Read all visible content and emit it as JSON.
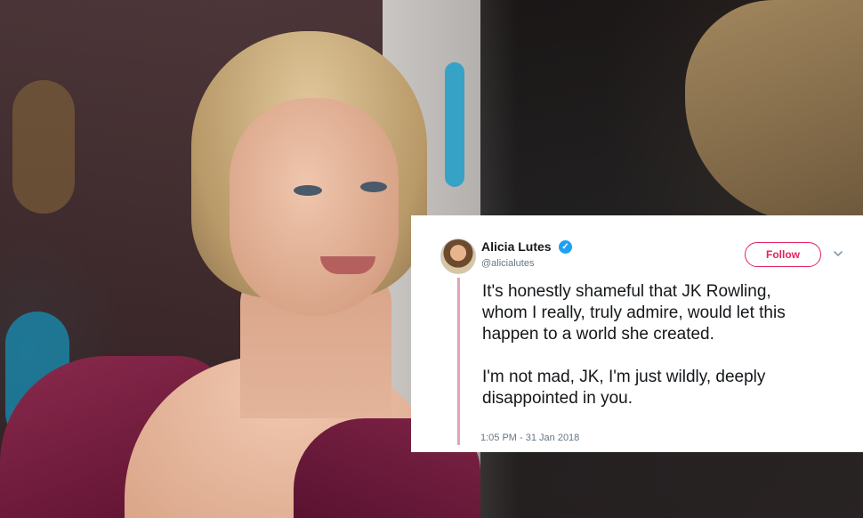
{
  "tweet": {
    "name": "Alicia Lutes",
    "handle": "@alicialutes",
    "follow_label": "Follow",
    "text": "It's honestly shameful that JK Rowling,\nwhom I really, truly admire, would let this\nhappen to a world she created.\n\nI'm not mad, JK, I'm just wildly, deeply\ndisappointed in you.",
    "timestamp": "1:05 PM - 31 Jan 2018",
    "colors": {
      "follow": "#e0245e",
      "verified": "#1da1f2",
      "thread_line": "#e3a3b8"
    },
    "icons": [
      "verified-badge-icon",
      "chevron-down-icon"
    ]
  }
}
